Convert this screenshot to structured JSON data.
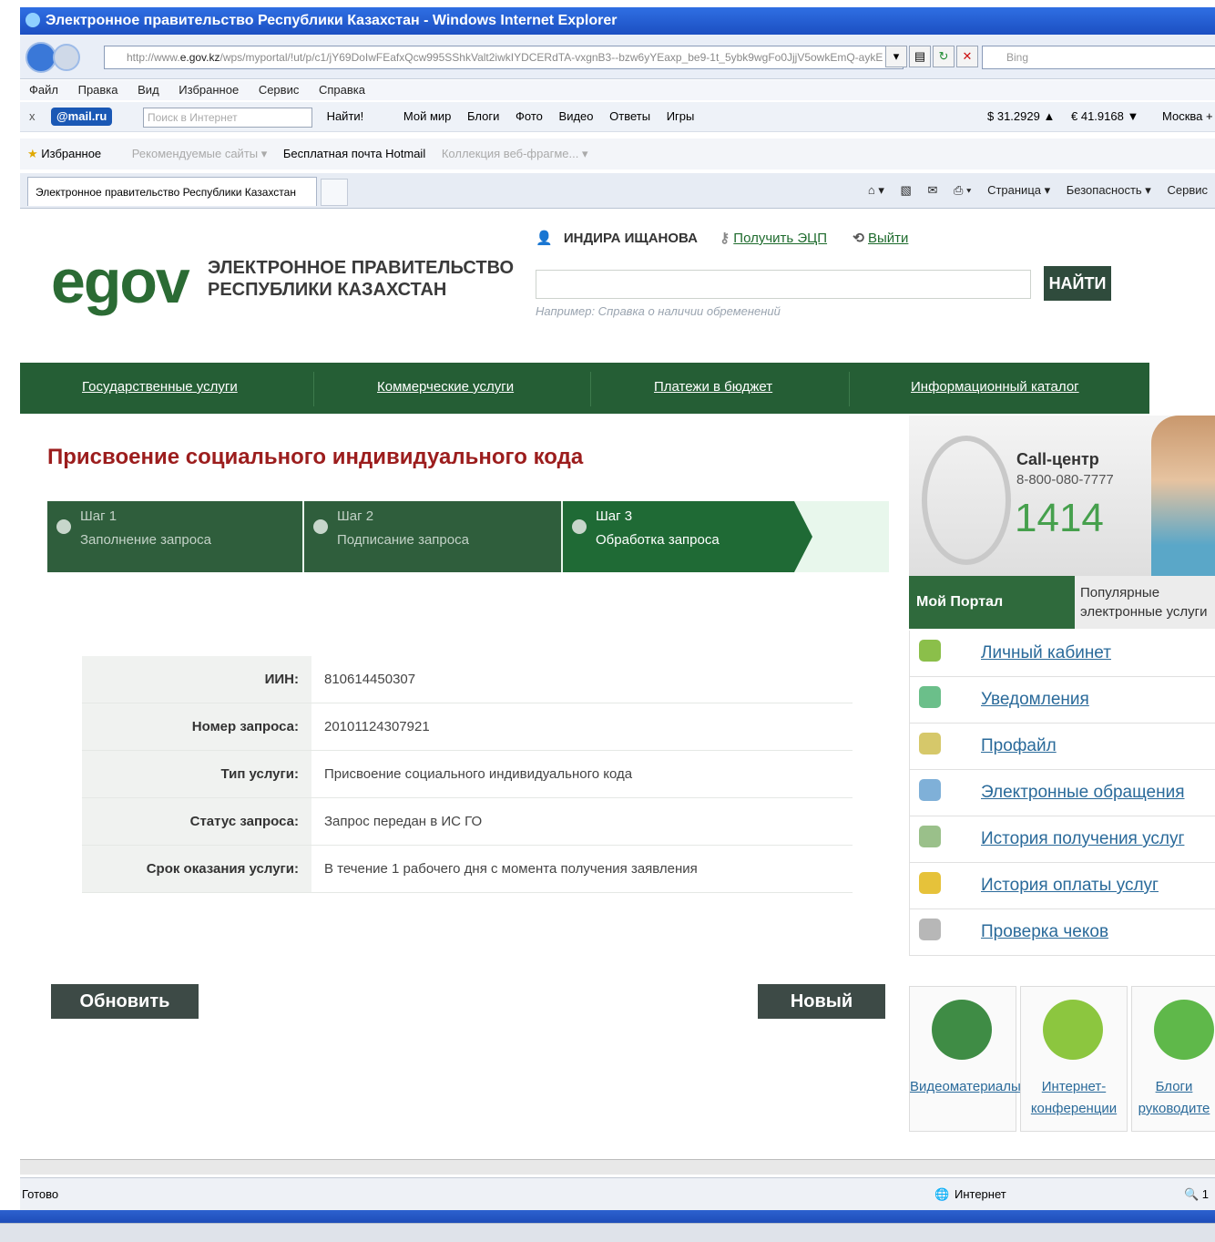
{
  "window": {
    "title": "Электронное правительство Республики Казахстан - Windows Internet Explorer"
  },
  "address": {
    "url_prefix": "http://www.",
    "url_host": "e.gov.kz",
    "url_rest": "/wps/myportal/!ut/p/c1/jY69DoIwFEafxQcw995SShkValt2iwkIYDCERdTA-vxgnB3--bzw6yYEaxp_be9-1t_5ybk9wgFo0JjjV5owkEmQ-aykE",
    "bing_placeholder": "Bing"
  },
  "menubar": [
    "Файл",
    "Правка",
    "Вид",
    "Избранное",
    "Сервис",
    "Справка"
  ],
  "toolbar": {
    "close": "x",
    "mail": "@mail.ru",
    "search_placeholder": "Поиск в Интернет",
    "find": "Найти!",
    "items": [
      "Мой мир",
      "Блоги",
      "Фото",
      "Видео",
      "Ответы",
      "Игры"
    ],
    "usd": "$ 31.2929 ▲",
    "eur": "€ 41.9168 ▼",
    "city": "Москва +"
  },
  "favbar": {
    "favorites": "Избранное",
    "recommended": "Рекомендуемые сайты ▾",
    "hotmail": "Бесплатная почта Hotmail",
    "webslices": "Коллекция веб-фрагме... ▾"
  },
  "tabbar": {
    "tab_title": "Электронное правительство Республики Казахстан",
    "commands": [
      "Страница ▾",
      "Безопасность ▾",
      "Сервис"
    ]
  },
  "header": {
    "logo": "egov",
    "logo_line1": "ЭЛЕКТРОННОЕ ПРАВИТЕЛЬСТВО",
    "logo_line2": "РЕСПУБЛИКИ КАЗАХСТАН",
    "user_name": "ИНДИРА ИЩАНОВА",
    "get_eds": "Получить ЭЦП",
    "logout": "Выйти",
    "search_button": "НАЙТИ",
    "search_example": "Например: Справка о наличии обременений"
  },
  "mainnav": [
    "Государственные услуги",
    "Коммерческие услуги",
    "Платежи в бюджет",
    "Информационный каталог"
  ],
  "main": {
    "heading": "Присвоение социального индивидуального кода",
    "steps": [
      {
        "title": "Шаг 1",
        "sub": "Заполнение запроса"
      },
      {
        "title": "Шаг 2",
        "sub": "Подписание запроса"
      },
      {
        "title": "Шаг 3",
        "sub": "Обработка запроса"
      }
    ],
    "info": [
      {
        "k": "ИИН:",
        "v": "810614450307"
      },
      {
        "k": "Номер запроса:",
        "v": "20101124307921"
      },
      {
        "k": "Тип услуги:",
        "v": "Присвоение социального индивидуального кода"
      },
      {
        "k": "Статус запроса:",
        "v": "Запрос передан в ИС ГО"
      },
      {
        "k": "Срок оказания услуги:",
        "v": "В течение 1 рабочего дня с момента получения заявления"
      }
    ],
    "refresh_button": "Обновить статус",
    "new_request_button": "Новый запрос"
  },
  "sidebar": {
    "call_title": "Call-центр",
    "call_phone": "8-800-080-7777",
    "call_short": "1414",
    "tab_my": "Мой Портал",
    "tab_popular": "Популярные электронные услуги",
    "menu": [
      {
        "label": "Личный кабинет",
        "color": "#8bbf4a"
      },
      {
        "label": "Уведомления",
        "color": "#6bbf8a"
      },
      {
        "label": "Профайл",
        "color": "#d6c86a"
      },
      {
        "label": "Электронные обращения",
        "color": "#7fb0d8"
      },
      {
        "label": "История получения услуг",
        "color": "#9ac08a"
      },
      {
        "label": "История оплаты услуг",
        "color": "#e6c23a"
      },
      {
        "label": "Проверка чеков",
        "color": "#b7b7b7"
      }
    ],
    "tiles": [
      {
        "label": "Видеоматериалы",
        "color": "#3f8c45"
      },
      {
        "label": "Интернет-конференции",
        "color": "#8cc63f"
      },
      {
        "label": "Блоги руководите",
        "color": "#5fb84a"
      }
    ]
  },
  "statusbar": {
    "left": "Готово",
    "zone": "Интернет",
    "zoom": "🔍 1"
  }
}
